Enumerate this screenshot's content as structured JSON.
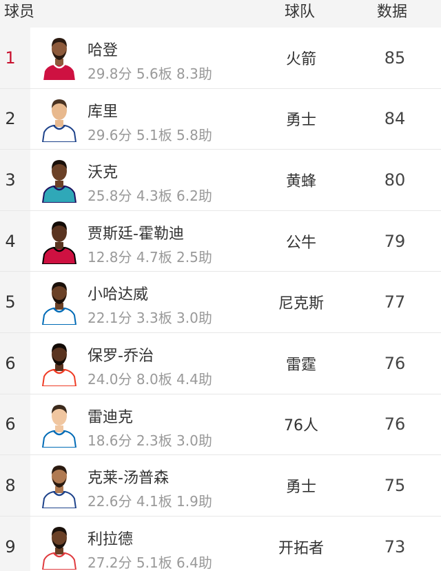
{
  "header": {
    "player_label": "球员",
    "team_label": "球队",
    "stat_label": "数据"
  },
  "colors": {
    "rank_highlight": "#c8102e",
    "rank_default": "#333333",
    "header_bg": "#f4f4f4",
    "subtext": "#999999"
  },
  "rows": [
    {
      "rank": "1",
      "name": "哈登",
      "stats": "29.8分 5.6板 8.3助",
      "team": "火箭",
      "score": "85",
      "skin": "#8d5a3b",
      "hair": "#2b1a10",
      "beard": true,
      "jersey": "#ce1141",
      "trim": "#ffffff",
      "icon": "player-harden-avatar-icon"
    },
    {
      "rank": "2",
      "name": "库里",
      "stats": "29.6分 5.1板 5.8助",
      "team": "勇士",
      "score": "84",
      "skin": "#e8b98e",
      "hair": "#4a3322",
      "beard": false,
      "jersey": "#ffffff",
      "trim": "#1d428a",
      "icon": "player-curry-avatar-icon"
    },
    {
      "rank": "3",
      "name": "沃克",
      "stats": "25.8分 4.3板 6.2助",
      "team": "黄蜂",
      "score": "80",
      "skin": "#6b4127",
      "hair": "#1a100a",
      "beard": false,
      "jersey": "#2fa8b8",
      "trim": "#1d1160",
      "icon": "player-walker-avatar-icon"
    },
    {
      "rank": "4",
      "name": "贾斯廷-霍勒迪",
      "stats": "12.8分 4.7板 2.5助",
      "team": "公牛",
      "score": "79",
      "skin": "#5a3420",
      "hair": "#120b06",
      "beard": false,
      "jersey": "#ce1141",
      "trim": "#000000",
      "icon": "player-holiday-avatar-icon"
    },
    {
      "rank": "5",
      "name": "小哈达威",
      "stats": "22.1分 3.3板 3.0助",
      "team": "尼克斯",
      "score": "77",
      "skin": "#6b4127",
      "hair": "#1a100a",
      "beard": true,
      "jersey": "#ffffff",
      "trim": "#006bb6",
      "icon": "player-hardaway-avatar-icon"
    },
    {
      "rank": "6",
      "name": "保罗-乔治",
      "stats": "24.0分 8.0板 4.4助",
      "team": "雷霆",
      "score": "76",
      "skin": "#5a3420",
      "hair": "#120b06",
      "beard": true,
      "jersey": "#ffffff",
      "trim": "#ef3b24",
      "icon": "player-george-avatar-icon"
    },
    {
      "rank": "6",
      "name": "雷迪克",
      "stats": "18.6分 2.3板 3.0助",
      "team": "76人",
      "score": "76",
      "skin": "#f0c6a0",
      "hair": "#3b2a1c",
      "beard": false,
      "jersey": "#ffffff",
      "trim": "#006bb6",
      "icon": "player-redick-avatar-icon"
    },
    {
      "rank": "8",
      "name": "克莱-汤普森",
      "stats": "22.6分 4.1板 1.9助",
      "team": "勇士",
      "score": "75",
      "skin": "#b07a52",
      "hair": "#2a1a10",
      "beard": true,
      "jersey": "#ffffff",
      "trim": "#1d428a",
      "icon": "player-thompson-avatar-icon"
    },
    {
      "rank": "9",
      "name": "利拉德",
      "stats": "27.2分 5.1板 6.4助",
      "team": "开拓者",
      "score": "73",
      "skin": "#6b4127",
      "hair": "#1a100a",
      "beard": true,
      "jersey": "#ffffff",
      "trim": "#e03a3e",
      "icon": "player-lillard-avatar-icon"
    }
  ]
}
